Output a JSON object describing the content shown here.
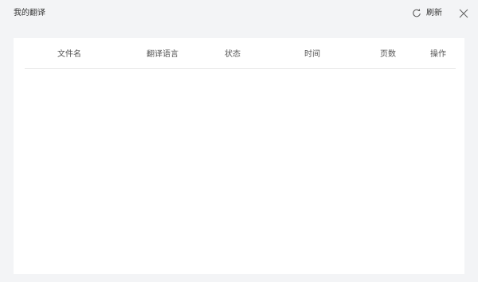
{
  "dialog": {
    "title": "我的翻译",
    "refresh_label": "刷新",
    "refresh_icon": "refresh-icon",
    "close_icon": "close-icon"
  },
  "table": {
    "columns": [
      "文件名",
      "翻译语言",
      "状态",
      "时间",
      "页数",
      "操作"
    ],
    "rows": []
  },
  "colors": {
    "background": "#f3f4f6",
    "panel": "#ffffff",
    "divider": "#e6e6e6",
    "text": "#333333"
  }
}
